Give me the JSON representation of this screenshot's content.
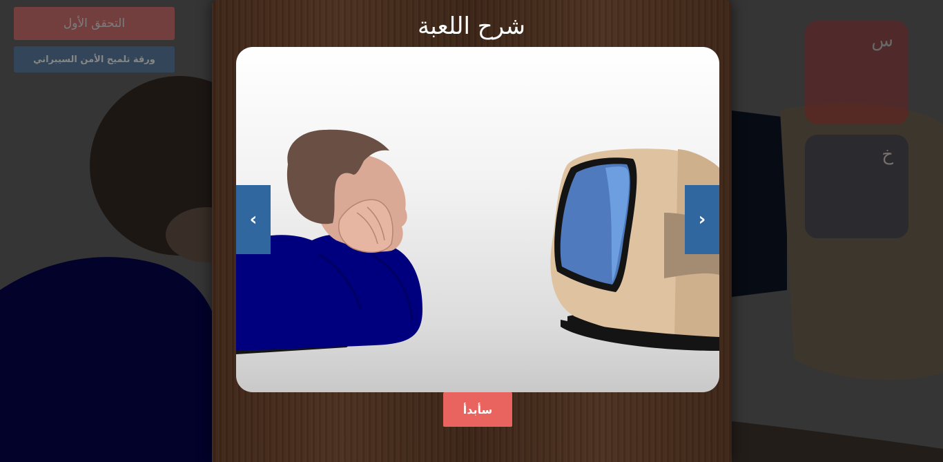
{
  "background": {
    "check_button_label": "التحقق الأول",
    "hint_sheet_button_label": "ورقة تلميح الأمن السيبراني",
    "cards": [
      {
        "letter": "س",
        "color": "#8e1212"
      },
      {
        "letter": "خ",
        "color": "#0b1431"
      }
    ]
  },
  "modal": {
    "title": "شرح اللعبة",
    "prev_label": "‹",
    "next_label": "›",
    "start_label": "سأبدأ",
    "slide_image": "boy-watching-tv-illustration"
  },
  "colors": {
    "nav_button": "#2f679e",
    "start_button": "#e9645f",
    "check_button": "#e8534f",
    "hint_button": "#2e5f8f"
  }
}
